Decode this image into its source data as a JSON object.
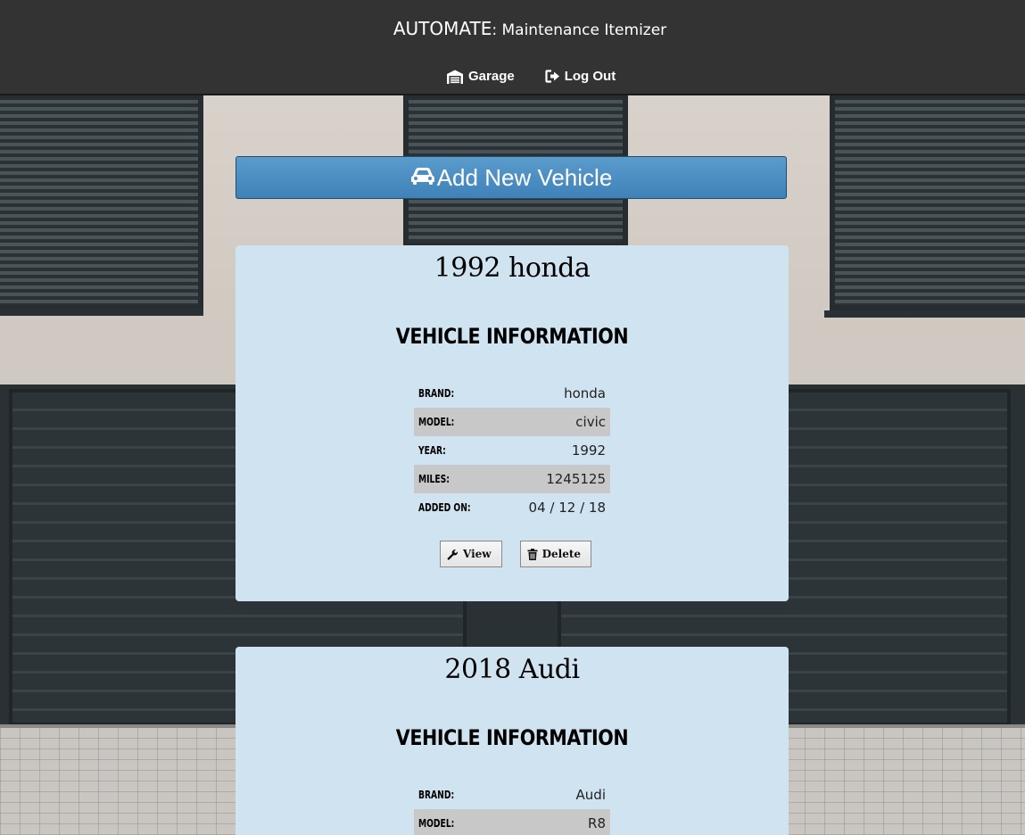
{
  "app": {
    "brand_main": "AUTOMATE",
    "brand_sub": ": Maintenance Itemizer"
  },
  "nav": {
    "garage_label": "Garage",
    "garage_icon": "garage-icon",
    "logout_label": "Log Out",
    "logout_icon": "sign-out-icon"
  },
  "add_vehicle": {
    "label": "Add New Vehicle",
    "icon": "car-icon"
  },
  "vehicles": [
    {
      "title": "1992 honda",
      "section_title": "VEHICLE INFORMATION",
      "rows": [
        {
          "label": "BRAND:",
          "value": "honda"
        },
        {
          "label": "MODEL:",
          "value": "civic"
        },
        {
          "label": "YEAR:",
          "value": "1992"
        },
        {
          "label": "MILES:",
          "value": "1245125"
        },
        {
          "label": "ADDED ON:",
          "value": "04 / 12 / 18"
        }
      ],
      "view_label": "View",
      "delete_label": "Delete"
    },
    {
      "title": "2018 Audi",
      "section_title": "VEHICLE INFORMATION",
      "rows": [
        {
          "label": "BRAND:",
          "value": "Audi"
        },
        {
          "label": "MODEL:",
          "value": "R8"
        }
      ]
    }
  ],
  "colors": {
    "header_bg": "#333333",
    "card_bg": "#d0e3f0",
    "button_blue": "#4a8dc2",
    "row_shade": "#c8c8c8"
  }
}
